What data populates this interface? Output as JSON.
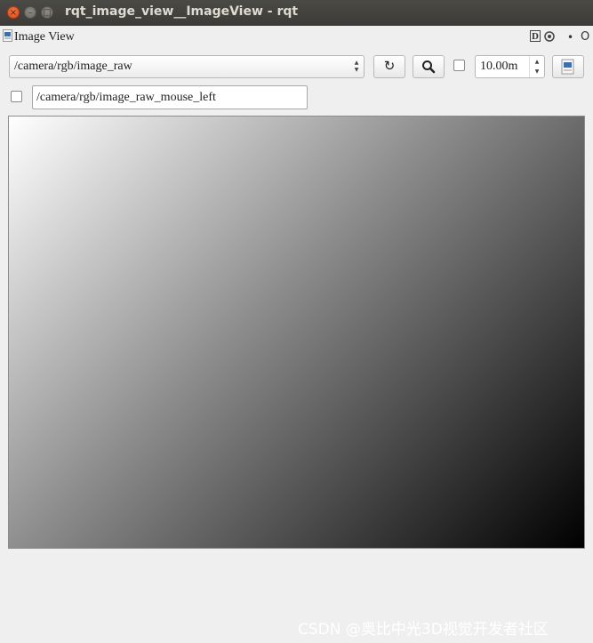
{
  "window": {
    "title": "rqt_image_view__ImageView - rqt",
    "close_glyph": "×",
    "min_glyph": "–",
    "max_glyph": "□"
  },
  "dock": {
    "title": "Image View",
    "d_label": "D",
    "options_label": "O",
    "dot_label": "•"
  },
  "toolbar": {
    "topic_selected": "/camera/rgb/image_raw",
    "refresh_icon": "↻",
    "smooth_checked": false,
    "rotation_value": "10.00m",
    "spin_up": "▲",
    "spin_down": "▼",
    "combo_arrows": "▲▼"
  },
  "mouse": {
    "publish_checked": false,
    "topic_value": "/camera/rgb/image_raw_mouse_left"
  },
  "colors": {
    "titlebar": "#3c3b37",
    "close_button": "#dd4814",
    "background": "#efefef"
  },
  "watermark": "CSDN @奥比中光3D视觉开发者社区"
}
